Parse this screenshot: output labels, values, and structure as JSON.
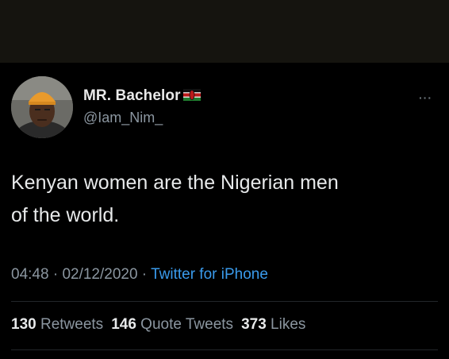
{
  "tweet": {
    "display_name": "MR. Bachelor",
    "flag_icon": "kenya-flag-icon",
    "handle": "@Iam_Nim_",
    "more_icon": "more-horizontal-icon",
    "more_label": "···",
    "text_line1": "Kenyan women are the Nigerian men",
    "text_line2": "of the world.",
    "time": "04:48",
    "separator": " · ",
    "date": "02/12/2020",
    "source": "Twitter for iPhone",
    "stats": {
      "retweets_count": "130",
      "retweets_label": "Retweets",
      "quotes_count": "146",
      "quotes_label": "Quote Tweets",
      "likes_count": "373",
      "likes_label": "Likes"
    }
  },
  "colors": {
    "background": "#000000",
    "top_bar": "#15140f",
    "primary_text": "#e7e9ea",
    "secondary_text": "#8b96a0",
    "link": "#3a9bec"
  }
}
